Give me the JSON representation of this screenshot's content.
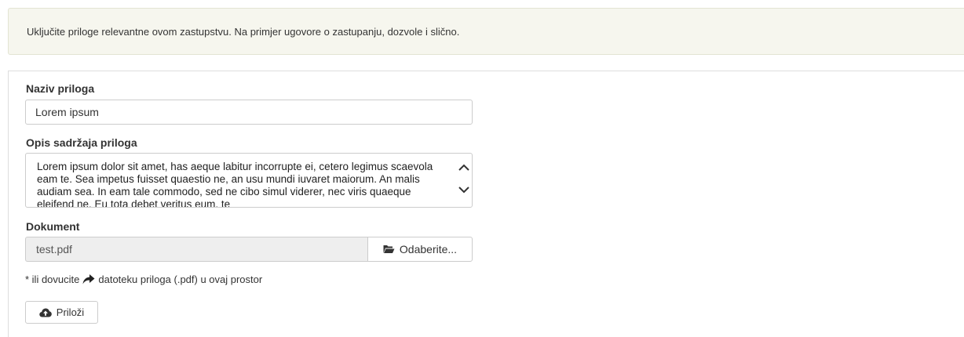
{
  "info": {
    "text": "Uključite priloge relevantne ovom zastupstvu. Na primjer ugovore o zastupanju, dozvole i slično."
  },
  "form": {
    "name_label": "Naziv priloga",
    "name_value": "Lorem ipsum",
    "description_label": "Opis sadržaja priloga",
    "description_value": "Lorem ipsum dolor sit amet, has aeque labitur incorrupte ei, cetero legimus scaevola eam te. Sea impetus fuisset quaestio ne, an usu mundi iuvaret maiorum. An malis audiam sea. In eam tale commodo, sed ne cibo simul viderer, nec viris quaeque eleifend ne. Eu tota debet veritus eum, te",
    "document_label": "Dokument",
    "document_value": "test.pdf",
    "browse_label": "Odaberite...",
    "hint_prefix": "* ili dovucite",
    "hint_suffix": "datoteku priloga (.pdf) u ovaj prostor",
    "attach_label": "Priloži"
  },
  "icons": {
    "browse": "folder-open-icon",
    "hint": "share-arrow-icon",
    "attach": "cloud-upload-icon",
    "scroll_up": "chevron-up-icon",
    "scroll_down": "chevron-down-icon"
  },
  "colors": {
    "info_background": "#f6f6ee",
    "info_border": "#e3e4d3",
    "input_border": "#cccccc",
    "readonly_background": "#eeeeee"
  }
}
